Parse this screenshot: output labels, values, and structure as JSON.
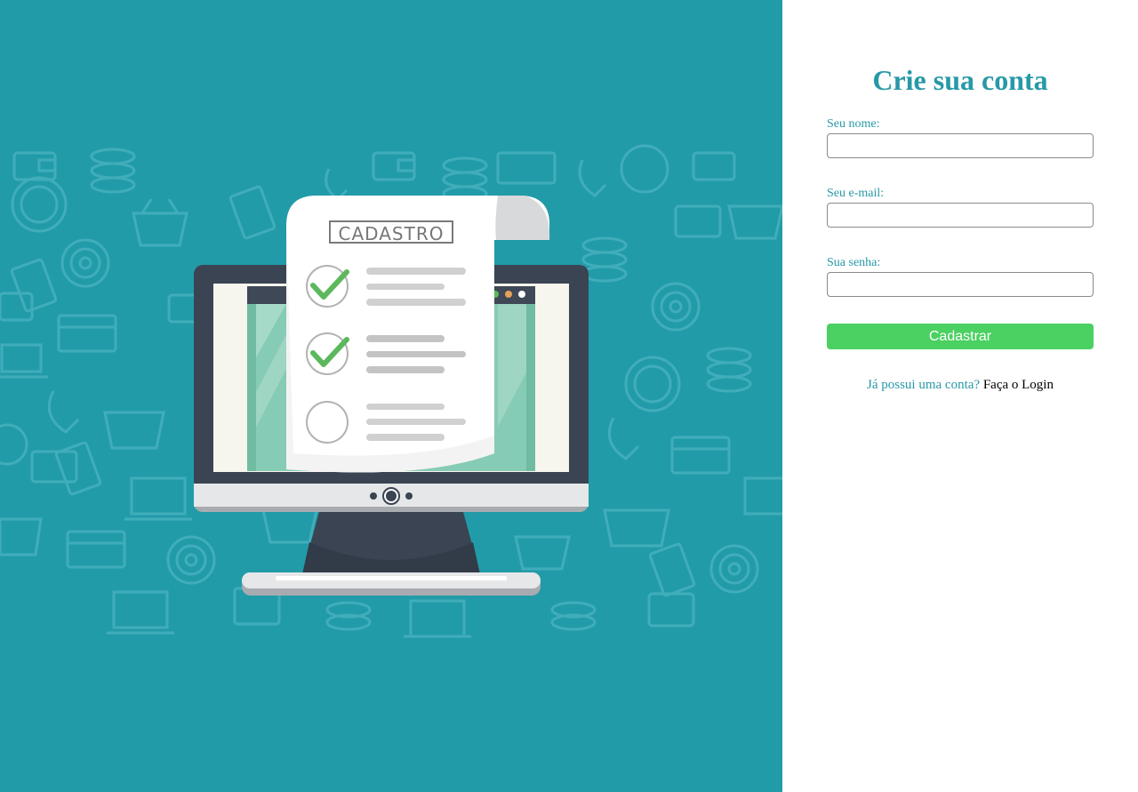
{
  "colors": {
    "hero_background": "#229ba9",
    "accent": "#2799a7",
    "button": "#4bd062",
    "monitor_frame": "#3a4453",
    "check_green": "#5cb85c"
  },
  "illustration": {
    "document_heading": "CADASTRO",
    "checklist": [
      {
        "icon": "check-icon",
        "checked": true
      },
      {
        "icon": "check-icon",
        "checked": true
      },
      {
        "icon": "empty-circle-icon",
        "checked": false
      }
    ],
    "background_icons": [
      "wallet-icon",
      "coins-icon",
      "basket-icon",
      "phone-icon",
      "target-icon",
      "laptop-icon",
      "credit-card-icon",
      "money-icon",
      "dollar-coin-icon"
    ]
  },
  "form": {
    "title": "Crie sua conta",
    "name_label": "Seu nome:",
    "name_value": "",
    "email_label": "Seu e-mail:",
    "email_value": "",
    "password_label": "Sua senha:",
    "password_value": "",
    "submit_label": "Cadastrar",
    "login_question": "Já possui uma conta?",
    "login_link": "Faça o Login"
  }
}
